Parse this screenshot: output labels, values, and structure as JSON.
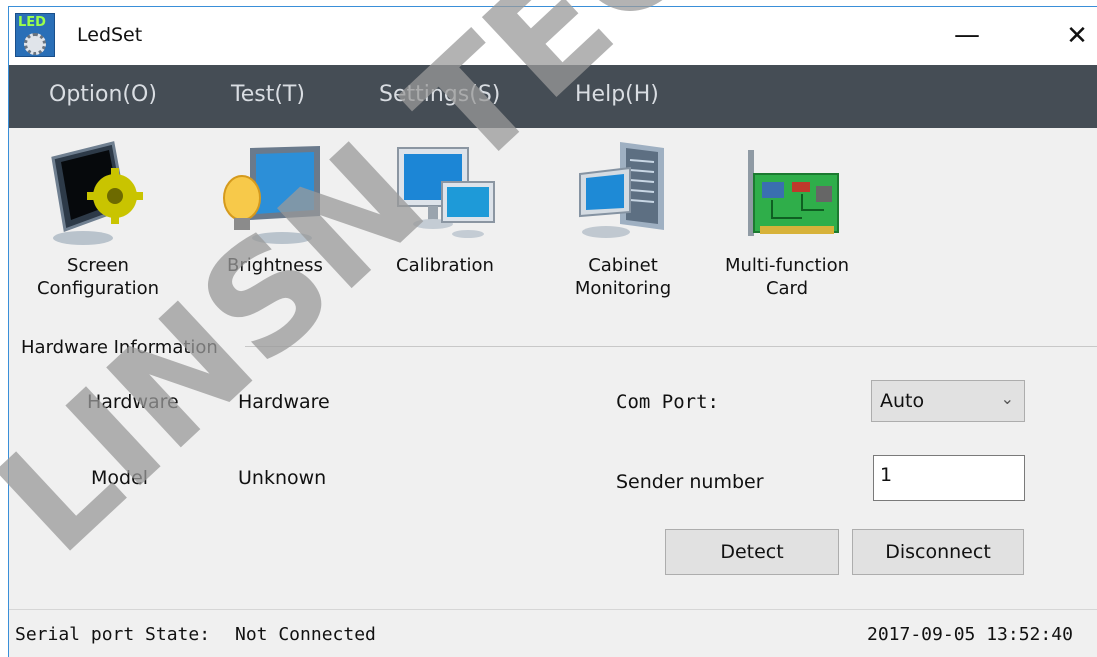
{
  "window": {
    "title": "LedSet",
    "app_icon_text": "LED",
    "minimize_glyph": "—",
    "close_glyph": "✕"
  },
  "menu": [
    {
      "label": "Option(O)"
    },
    {
      "label": "Test(T)"
    },
    {
      "label": "Settings(S)"
    },
    {
      "label": "Help(H)"
    }
  ],
  "toolbar": {
    "screen_config": {
      "line1": "Screen",
      "line2": "Configuration",
      "icon": "monitor-gear-icon"
    },
    "brightness": {
      "label": "Brightness",
      "icon": "monitor-bulb-icon"
    },
    "calibration": {
      "label": "Calibration",
      "icon": "dual-monitor-icon"
    },
    "cabinet": {
      "line1": "Cabinet",
      "line2": "Monitoring",
      "icon": "server-monitor-icon"
    },
    "multi_card": {
      "line1": "Multi-function",
      "line2": "Card",
      "icon": "circuit-card-icon"
    }
  },
  "hardware": {
    "group_title": "Hardware Information",
    "hardware_label": "Hardware",
    "hardware_value": "Hardware",
    "model_label": "Model",
    "model_value": "Unknown",
    "com_port_label": "Com Port:",
    "com_port_value": "Auto",
    "sender_label": "Sender number",
    "sender_value": "1",
    "detect_label": "Detect",
    "disconnect_label": "Disconnect"
  },
  "status": {
    "serial_label": "Serial port State:",
    "serial_value": "Not Connected",
    "datetime": "2017-09-05 13:52:40"
  },
  "watermark": {
    "text": "LINSN TECH",
    "color": "#9a9a9a"
  }
}
